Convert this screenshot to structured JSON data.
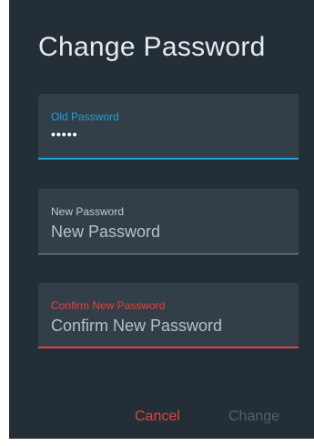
{
  "dialog": {
    "title": "Change Password",
    "fields": [
      {
        "label": "Old Password",
        "value": "•••••",
        "state": "focused",
        "accent": "#1fa1dc"
      },
      {
        "label": "New Password",
        "placeholder": "New Password",
        "state": "default",
        "accent": "#8a959c"
      },
      {
        "label": "Confirm New Password",
        "placeholder": "Confirm New Password",
        "state": "error",
        "accent": "#e2453c"
      }
    ],
    "buttons": {
      "cancel": "Cancel",
      "change": "Change"
    }
  },
  "colors": {
    "background": "#232e37",
    "field_background": "#323e48",
    "focus": "#1fa1dc",
    "error": "#e2453c",
    "disabled": "#56606a"
  }
}
